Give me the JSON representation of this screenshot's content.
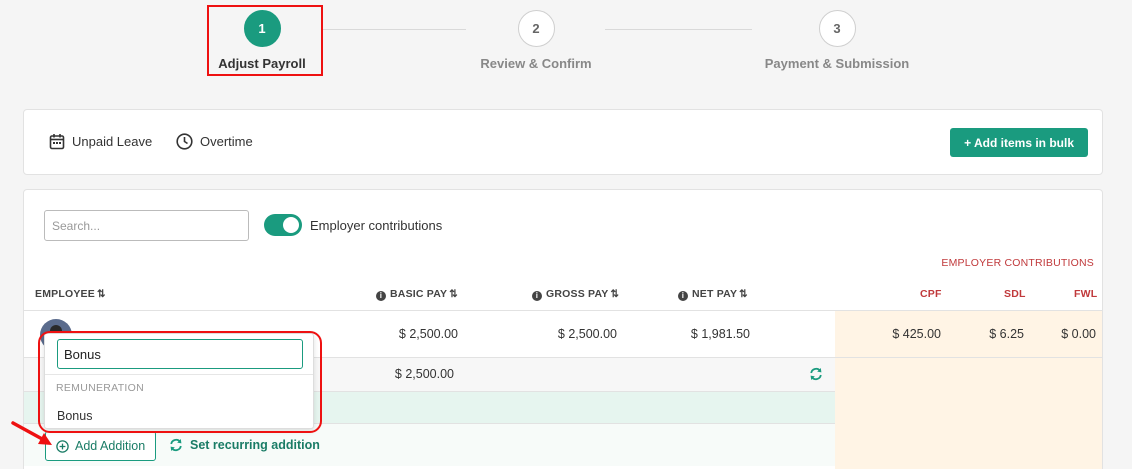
{
  "stepper": {
    "steps": [
      {
        "number": "1",
        "label": "Adjust Payroll"
      },
      {
        "number": "2",
        "label": "Review & Confirm"
      },
      {
        "number": "3",
        "label": "Payment & Submission"
      }
    ]
  },
  "toolbar": {
    "unpaid_leave": "Unpaid Leave",
    "overtime": "Overtime",
    "bulk_button": "+ Add items in bulk"
  },
  "filters": {
    "search_placeholder": "Search...",
    "toggle_label": "Employer contributions",
    "toggle_on": true
  },
  "table": {
    "employer_contributions_header": "EMPLOYER CONTRIBUTIONS",
    "headers": {
      "employee": "EMPLOYEE",
      "basic_pay": "BASIC PAY",
      "gross_pay": "GROSS PAY",
      "net_pay": "NET PAY",
      "cpf": "CPF",
      "sdl": "SDL",
      "fwl": "FWL"
    },
    "row": {
      "basic_pay": "$ 2,500.00",
      "gross_pay": "$ 2,500.00",
      "net_pay": "$ 1,981.50",
      "cpf": "$ 425.00",
      "sdl": "$ 6.25",
      "fwl": "$ 0.00"
    },
    "subrow": {
      "basic_pay": "$ 2,500.00"
    }
  },
  "actions": {
    "add_addition": "Add Addition",
    "set_recurring": "Set recurring addition"
  },
  "dropdown": {
    "input_value": "Bonus",
    "group_label": "REMUNERATION",
    "option": "Bonus"
  },
  "colors": {
    "accent": "#1a9b7f",
    "highlight": "#e11111",
    "contribution_text": "#c0393b",
    "contribution_bg": "#fff4e5"
  }
}
